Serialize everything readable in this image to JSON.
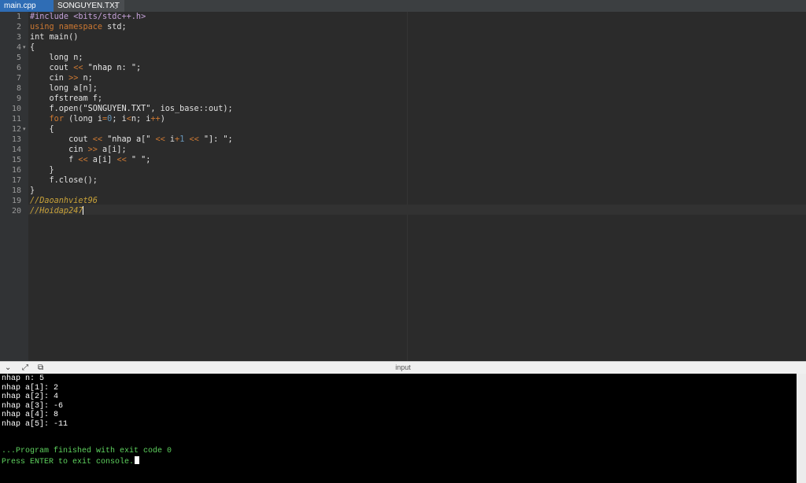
{
  "tabs": [
    {
      "label": "main.cpp",
      "active": true
    },
    {
      "label": "SONGUYEN.TXT",
      "active": false,
      "menu_icon": "vertical-dots-icon"
    }
  ],
  "editor": {
    "lines": [
      {
        "n": "1",
        "fold": ""
      },
      {
        "n": "2",
        "fold": ""
      },
      {
        "n": "3",
        "fold": ""
      },
      {
        "n": "4",
        "fold": "▾"
      },
      {
        "n": "5",
        "fold": ""
      },
      {
        "n": "6",
        "fold": ""
      },
      {
        "n": "7",
        "fold": ""
      },
      {
        "n": "8",
        "fold": ""
      },
      {
        "n": "9",
        "fold": ""
      },
      {
        "n": "10",
        "fold": ""
      },
      {
        "n": "11",
        "fold": ""
      },
      {
        "n": "12",
        "fold": "▾"
      },
      {
        "n": "13",
        "fold": ""
      },
      {
        "n": "14",
        "fold": ""
      },
      {
        "n": "15",
        "fold": ""
      },
      {
        "n": "16",
        "fold": ""
      },
      {
        "n": "17",
        "fold": ""
      },
      {
        "n": "18",
        "fold": ""
      },
      {
        "n": "19",
        "fold": ""
      },
      {
        "n": "20",
        "fold": ""
      }
    ],
    "code": {
      "l1_a": "#include ",
      "l1_b": "<bits/stdc++.h>",
      "l2_a": "using namespace",
      "l2_b": " std;",
      "l3": "int main()",
      "l4": "{",
      "l5": "    long n;",
      "l6_a": "    cout ",
      "l6_b": "<<",
      "l6_c": " \"nhap n: \";",
      "l7_a": "    cin ",
      "l7_b": ">>",
      "l7_c": " n;",
      "l8": "    long a[n];",
      "l9": "    ofstream f;",
      "l10_a": "    f.open(",
      "l10_b": "\"SONGUYEN.TXT\"",
      "l10_c": ", ios_base::out);",
      "l11_a": "    ",
      "l11_b": "for",
      "l11_c": " (long i",
      "l11_d": "=",
      "l11_e": "0",
      "l11_f": "; i",
      "l11_g": "<",
      "l11_h": "n; i",
      "l11_i": "++",
      "l11_j": ")",
      "l12": "    {",
      "l13_a": "        cout ",
      "l13_b": "<<",
      "l13_c": " \"nhap a[\" ",
      "l13_d": "<<",
      "l13_e": " i",
      "l13_f": "+",
      "l13_g": "1",
      "l13_h": " ",
      "l13_i": "<<",
      "l13_j": " \"]: \";",
      "l14_a": "        cin ",
      "l14_b": ">>",
      "l14_c": " a[i];",
      "l15_a": "        f ",
      "l15_b": "<<",
      "l15_c": " a[i] ",
      "l15_d": "<<",
      "l15_e": " \" \";",
      "l16": "    }",
      "l17": "    f.close();",
      "l18": "}",
      "l19": "//Daoanhviet96",
      "l20": "//Hoidap247"
    }
  },
  "console": {
    "toolbar": {
      "collapse_icon": "chevron-down-icon",
      "expand_icon": "expand-arrows-icon",
      "copy_icon": "copy-icon",
      "label": "input"
    },
    "output": [
      "nhap n: 5",
      "nhap a[1]: 2",
      "nhap a[2]: 4",
      "nhap a[3]: -6",
      "nhap a[4]: 8",
      "nhap a[5]: -11"
    ],
    "finished": "...Program finished with exit code 0",
    "press_enter": "Press ENTER to exit console."
  },
  "colors": {
    "active_tab": "#2f6db5",
    "editor_bg": "#2b2b2b",
    "keyword": "#cc7832",
    "comment": "#c8a23a",
    "console_green": "#5fd35f"
  }
}
